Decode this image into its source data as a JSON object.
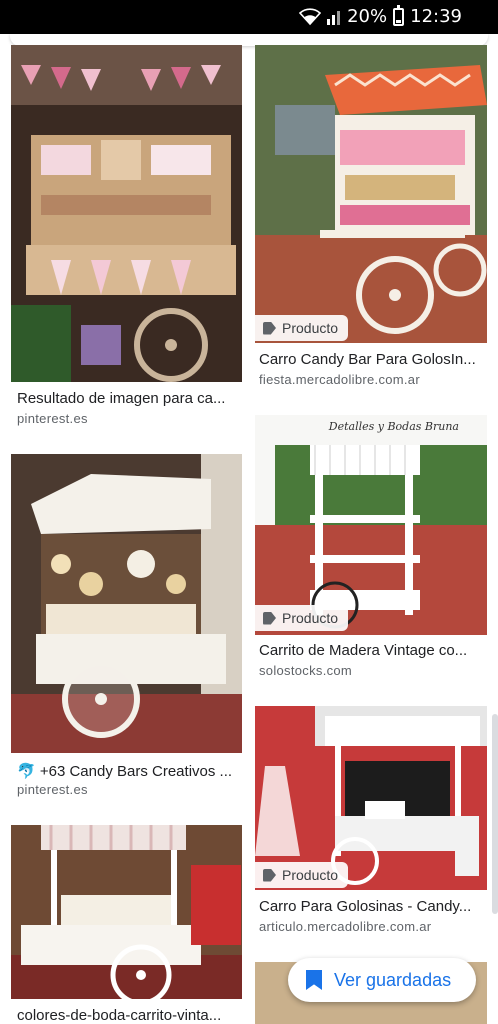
{
  "status_bar": {
    "battery": "20%",
    "time": "12:39"
  },
  "results": [
    {
      "caption": "Resultado de imagen para ca...",
      "source": "pinterest.es",
      "badge": ""
    },
    {
      "caption": "Carro Candy Bar Para GolosIn...",
      "source": "fiesta.mercadolibre.com.ar",
      "badge": "Producto"
    },
    {
      "caption": "+63 Candy Bars Creativos ...",
      "source": "pinterest.es",
      "badge": "",
      "caption_icon": "fish-emoji-icon"
    },
    {
      "caption": "Carrito de Madera Vintage co...",
      "source": "solostocks.com",
      "badge": "Producto",
      "image_text": "Detalles y Bodas Bruna"
    },
    {
      "caption": "Carro Para Golosinas - Candy...",
      "source": "articulo.mercadolibre.com.ar",
      "badge": "Producto"
    },
    {
      "caption": "colores-de-boda-carrito-vinta...",
      "source": "",
      "badge": ""
    }
  ],
  "fab": {
    "label": "Ver guardadas"
  },
  "colors": {
    "accent": "#1a73e8",
    "text": "#202124",
    "muted": "#5f6368"
  }
}
